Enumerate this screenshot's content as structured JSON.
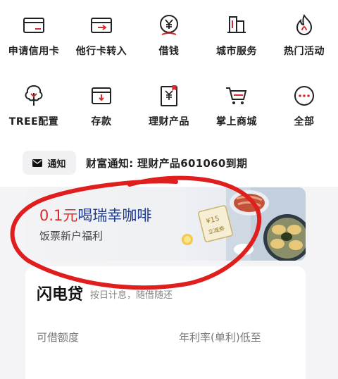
{
  "grid": [
    {
      "label": "申请信用卡",
      "icon": "credit-card-apply-icon"
    },
    {
      "label": "他行卡转入",
      "icon": "card-transfer-in-icon"
    },
    {
      "label": "借钱",
      "icon": "yen-coin-icon"
    },
    {
      "label": "城市服务",
      "icon": "city-building-icon"
    },
    {
      "label": "热门活动",
      "icon": "flame-icon"
    },
    {
      "label": "TREE配置",
      "icon": "tree-icon"
    },
    {
      "label": "存款",
      "icon": "deposit-box-icon"
    },
    {
      "label": "理财产品",
      "icon": "finance-document-icon"
    },
    {
      "label": "掌上商城",
      "icon": "shopping-cart-icon"
    },
    {
      "label": "全部",
      "icon": "more-dots-icon"
    }
  ],
  "notice": {
    "tag_label": "通知",
    "text": "财富通知: 理财产品601060到期"
  },
  "banner": {
    "price": "0.1元",
    "title_rest": "喝瑞幸咖啡",
    "subtitle": "饭票新户福利",
    "coupon_amount": "¥15",
    "coupon_tag": "立减券"
  },
  "loan": {
    "title": "闪电贷",
    "slogan": "按日计息，随借随还",
    "limit_label": "可借额度",
    "rate_label": "年利率(单利)低至"
  },
  "colors": {
    "accent_red": "#d62b2f",
    "banner_blue": "#1f3a8a",
    "annotation_red": "#e01e1e"
  }
}
